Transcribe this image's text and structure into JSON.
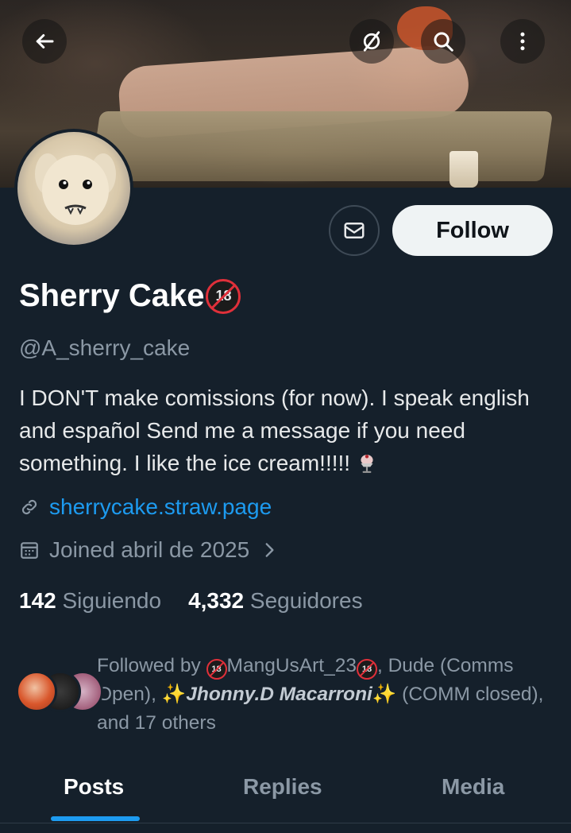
{
  "header": {
    "back_icon": "arrow-left-icon",
    "grok_icon": "grok-icon",
    "search_icon": "search-icon",
    "more_icon": "more-vertical-icon"
  },
  "profile": {
    "display_name": "Sherry Cake",
    "name_badge": "18",
    "handle": "@A_sherry_cake",
    "bio": "I DON'T make comissions (for now). I speak english and español Send me a message if you need something. I like the ice cream!!!!!",
    "bio_emoji": "ice-cream-icon",
    "link": "sherrycake.straw.page",
    "joined": "Joined abril de 2025"
  },
  "actions": {
    "message_icon": "mail-icon",
    "follow_label": "Follow"
  },
  "stats": {
    "following_count": "142",
    "following_label": "Siguiendo",
    "followers_count": "4,332",
    "followers_label": "Seguidores"
  },
  "followed_by": {
    "prefix": "Followed by ",
    "user1": "MangUsArt_23",
    "mid1": ", Dude (Comms Open), ",
    "user3": "Jhonny.D Macarroni",
    "suffix": " (COMM closed), and 17 others"
  },
  "tabs": [
    {
      "label": "Posts",
      "active": true
    },
    {
      "label": "Replies",
      "active": false
    },
    {
      "label": "Media",
      "active": false
    }
  ],
  "colors": {
    "background": "#15202b",
    "link": "#1d9bf0",
    "badge": "#e0303a"
  }
}
